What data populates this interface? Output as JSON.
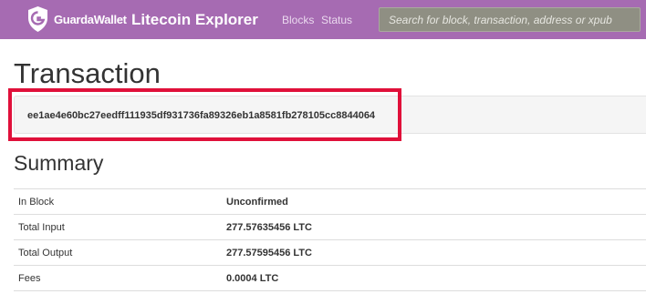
{
  "header": {
    "brand": "GuardaWallet",
    "app_title": "Litecoin Explorer",
    "nav": {
      "blocks": "Blocks",
      "status": "Status"
    },
    "search_placeholder": "Search for block, transaction, address or xpub"
  },
  "page": {
    "title": "Transaction",
    "txid": "ee1ae4e60bc27eedff111935df931736fa89326eb1a8581fb278105cc8844064"
  },
  "summary": {
    "title": "Summary",
    "rows": [
      {
        "label": "In Block",
        "value": "Unconfirmed"
      },
      {
        "label": "Total Input",
        "value": "277.57635456 LTC"
      },
      {
        "label": "Total Output",
        "value": "277.57595456 LTC"
      },
      {
        "label": "Fees",
        "value": "0.0004 LTC"
      }
    ]
  },
  "colors": {
    "navbar": "#a66bb2",
    "highlight": "#e0103a"
  }
}
